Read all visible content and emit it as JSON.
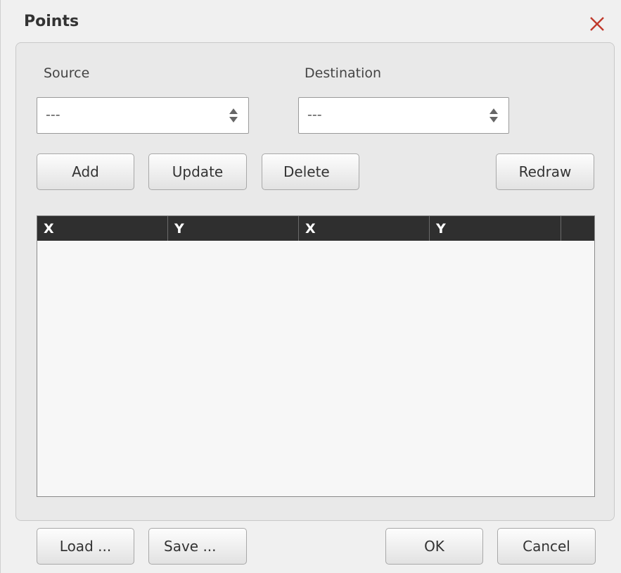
{
  "dialog": {
    "title": "Points",
    "close_icon": "close-x-icon",
    "accent_color": "#c0392b"
  },
  "source": {
    "label": "Source",
    "selected": "---"
  },
  "destination": {
    "label": "Destination",
    "selected": "---"
  },
  "actions": {
    "add": "Add",
    "update": "Update",
    "delete": "Delete",
    "redraw": "Redraw"
  },
  "table": {
    "columns": [
      "X",
      "Y",
      "X",
      "Y",
      ""
    ],
    "rows": []
  },
  "footer": {
    "load": "Load ...",
    "save": "Save ...",
    "ok": "OK",
    "cancel": "Cancel"
  }
}
